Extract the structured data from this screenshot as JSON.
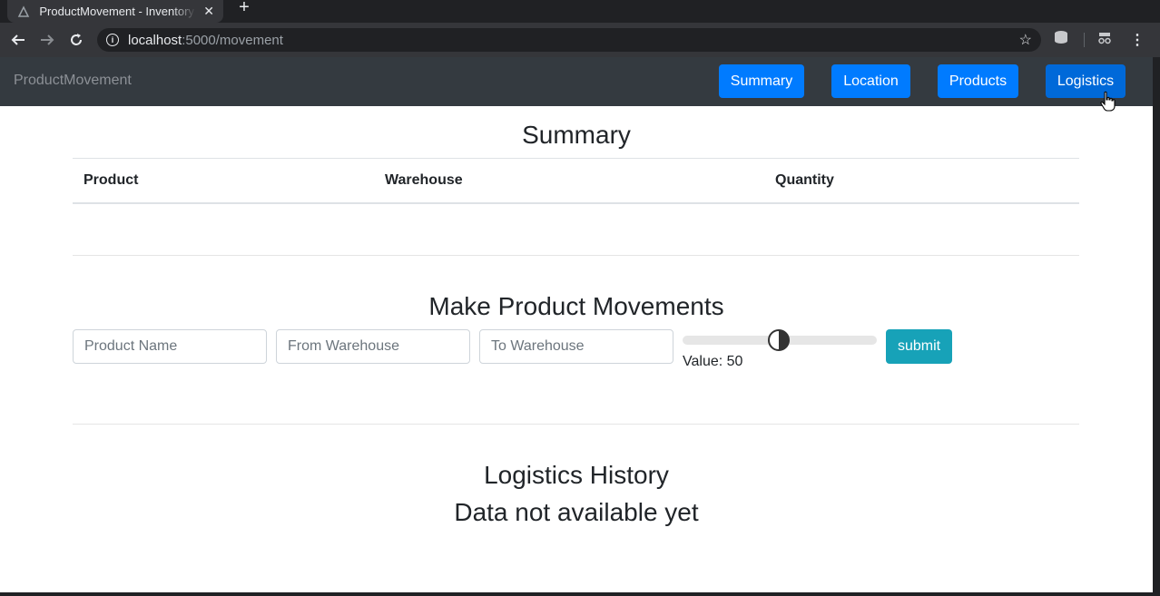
{
  "browser": {
    "tab_title": "ProductMovement - Inventory",
    "url_host": "localhost",
    "url_path": ":5000/movement"
  },
  "navbar": {
    "brand": "ProductMovement",
    "items": [
      {
        "label": "Summary"
      },
      {
        "label": "Location"
      },
      {
        "label": "Products"
      },
      {
        "label": "Logistics"
      }
    ]
  },
  "summary": {
    "title": "Summary",
    "columns": [
      "Product",
      "Warehouse",
      "Quantity"
    ]
  },
  "movement": {
    "title": "Make Product Movements",
    "product_placeholder": "Product Name",
    "from_placeholder": "From Warehouse",
    "to_placeholder": "To Warehouse",
    "slider_value": 50,
    "value_label": "Value: 50",
    "submit_label": "submit"
  },
  "history": {
    "title": "Logistics History",
    "empty_text": "Data not available yet"
  },
  "colors": {
    "primary": "#007bff",
    "info": "#17a2b8",
    "navbar": "#343a40"
  }
}
